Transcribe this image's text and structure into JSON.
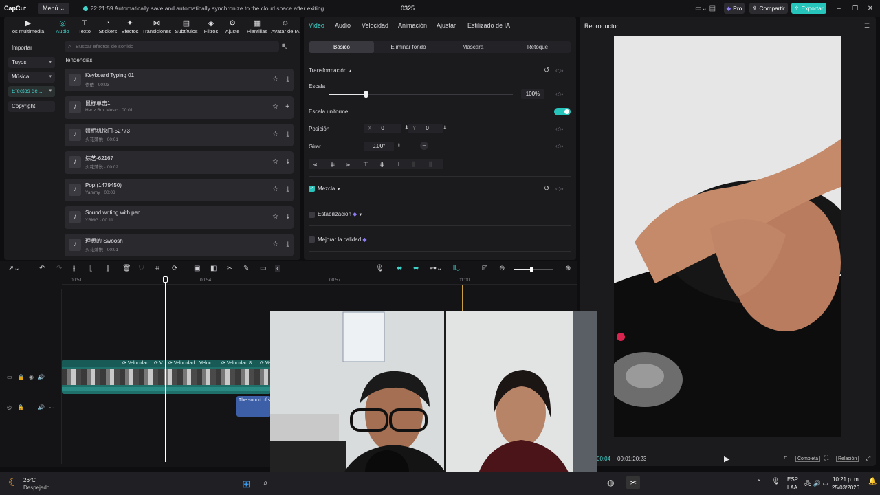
{
  "titlebar": {
    "logo": "CapCut",
    "menu_label": "Menú ⌄",
    "autosave_message": "22:21:59 Automatically save and automatically synchronize to the cloud space after exiting",
    "project_name": "0325",
    "pro_label": "Pro",
    "share_label": "Compartir",
    "export_label": "Exportar"
  },
  "media_panel": {
    "tabs": [
      {
        "label": "os multimedia",
        "icon": "media-icon"
      },
      {
        "label": "Audio",
        "icon": "audio-icon",
        "active": true
      },
      {
        "label": "Texto",
        "icon": "text-icon"
      },
      {
        "label": "Stickers",
        "icon": "sticker-icon"
      },
      {
        "label": "Efectos",
        "icon": "effects-icon"
      },
      {
        "label": "Transiciones",
        "icon": "transition-icon"
      },
      {
        "label": "Subtítulos",
        "icon": "subtitles-icon"
      },
      {
        "label": "Filtros",
        "icon": "filter-icon"
      },
      {
        "label": "Ajuste",
        "icon": "adjust-icon"
      },
      {
        "label": "Plantillas",
        "icon": "template-icon"
      },
      {
        "label": "Avatar de IA",
        "icon": "avatar-icon"
      }
    ],
    "side_items": [
      {
        "label": "Importar"
      },
      {
        "label": "Tuyos"
      },
      {
        "label": "Música"
      },
      {
        "label": "Efectos de ..."
      },
      {
        "label": "Copyright"
      }
    ],
    "search_placeholder": "Buscar efectos de sonido",
    "section_title": "Tendencias",
    "sounds": [
      {
        "title": "Keyboard Typing 01",
        "sub": "依依 · 00:03"
      },
      {
        "title": "鼠标单击1",
        "sub": "Hertz Box Music · 00:01"
      },
      {
        "title": "照相机快门-52773",
        "sub": "火花蒲悦 · 00:01"
      },
      {
        "title": "综艺-62167",
        "sub": "火花蒲悦 · 00:02"
      },
      {
        "title": "Pop!(1479450)",
        "sub": "Yammy · 00:03"
      },
      {
        "title": "Sound writing with pen",
        "sub": "YBMG · 00:11"
      },
      {
        "title": "理想的 Swoosh",
        "sub": "火花蒲悦 · 00:01"
      }
    ]
  },
  "properties": {
    "tabs": [
      "Video",
      "Audio",
      "Velocidad",
      "Animación",
      "Ajustar",
      "Estilizado de IA"
    ],
    "subtabs": [
      "Básico",
      "Eliminar fondo",
      "Máscara",
      "Retoque"
    ],
    "transform_title": "Transformación",
    "scale_label": "Escala",
    "scale_value": "100%",
    "scale_fraction": 0.2,
    "uniform_label": "Escala uniforme",
    "position_label": "Posición",
    "pos_x_label": "X",
    "pos_x": "0",
    "pos_y_label": "Y",
    "pos_y": "0",
    "rotate_label": "Girar",
    "rotate_value": "0.00°",
    "blend_label": "Mezcla",
    "stabilize_label": "Estabilización",
    "enhance_label": "Mejorar la calidad"
  },
  "player": {
    "title": "Reproductor",
    "current_time": "00:04",
    "total_time": "00:01:20:23",
    "full_label": "Completa",
    "ratio_label": "Relación"
  },
  "timeline": {
    "ticks": [
      "00:51",
      "00:54",
      "00:57",
      "01:00"
    ],
    "clip_labels": [
      "Velocidad",
      "V",
      "Velocidad",
      "Veloc",
      "Velocidad 8",
      "Ve"
    ],
    "text_clip": "The sound of s"
  },
  "taskbar": {
    "temperature": "26°C",
    "weather": "Despejado",
    "lang": "ESP",
    "layout": "LAA",
    "time": "10:21 p. m.",
    "date": "25/03/2026"
  },
  "colors": {
    "accent": "#3fd3c9",
    "clip_teal": "#1f6f6a",
    "text_clip": "#3d5fa8",
    "playhead": "#ffffff",
    "marker": "#c9a044"
  }
}
